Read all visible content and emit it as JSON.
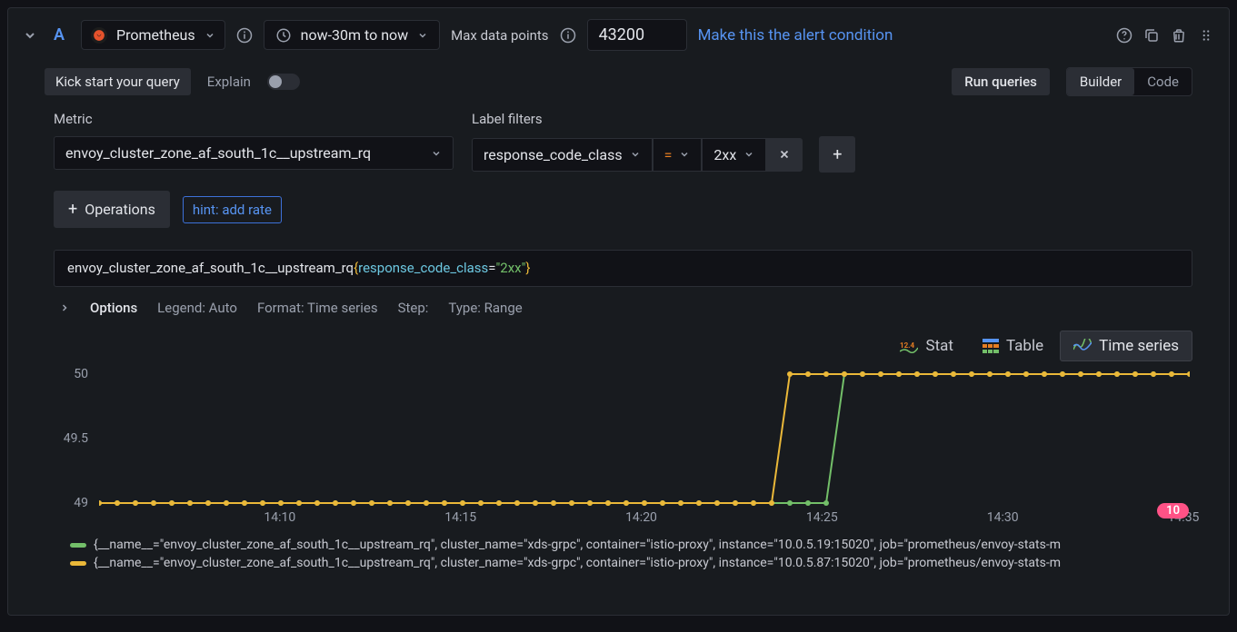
{
  "header": {
    "query_letter": "A",
    "datasource": "Prometheus",
    "time_range": "now-30m to now",
    "max_data_points_label": "Max data points",
    "max_data_points_value": "43200",
    "alert_link": "Make this the alert condition"
  },
  "row2": {
    "kick_start": "Kick start your query",
    "explain": "Explain",
    "run_queries": "Run queries",
    "builder": "Builder",
    "code": "Code"
  },
  "builder": {
    "metric_label": "Metric",
    "metric_value": "envoy_cluster_zone_af_south_1c__upstream_rq",
    "label_filters_label": "Label filters",
    "filter_key": "response_code_class",
    "filter_op": "=",
    "filter_value": "2xx",
    "operations_btn": "Operations",
    "hint": "hint: add rate"
  },
  "query_parts": {
    "metric": "envoy_cluster_zone_af_south_1c__upstream_rq",
    "label": "response_code_class",
    "eq": "=",
    "value": "\"2xx\""
  },
  "options": {
    "title": "Options",
    "legend": "Legend: Auto",
    "format": "Format: Time series",
    "step": "Step:",
    "type": "Type: Range"
  },
  "views": {
    "stat": "Stat",
    "table": "Table",
    "time_series": "Time series"
  },
  "chart_data": {
    "type": "line",
    "xlabel": "",
    "ylabel": "",
    "ylim": [
      49,
      50
    ],
    "y_ticks": [
      49,
      49.5,
      50
    ],
    "x_ticks": [
      "14:10",
      "14:15",
      "14:20",
      "14:25",
      "14:30",
      "14:35"
    ],
    "x_range_minutes": [
      0,
      30
    ],
    "x_tick_minutes": [
      5,
      10,
      15,
      20,
      25,
      30
    ],
    "series": [
      {
        "name": "{__name__=\"envoy_cluster_zone_af_south_1c__upstream_rq\", cluster_name=\"xds-grpc\", container=\"istio-proxy\", instance=\"10.0.5.19:15020\", job=\"prometheus/envoy-stats-m",
        "color": "#73bf69",
        "x": [
          0,
          0.5,
          1,
          1.5,
          2,
          2.5,
          3,
          3.5,
          4,
          4.5,
          5,
          5.5,
          6,
          6.5,
          7,
          7.5,
          8,
          8.5,
          9,
          9.5,
          10,
          10.5,
          11,
          11.5,
          12,
          12.5,
          13,
          13.5,
          14,
          14.5,
          15,
          15.5,
          16,
          16.5,
          17,
          17.5,
          18,
          18.5,
          19,
          19.5,
          20,
          20.5,
          21,
          21.5,
          22,
          22.5,
          23,
          23.5,
          24,
          24.5,
          25,
          25.5,
          26,
          26.5,
          27,
          27.5,
          28,
          28.5,
          29,
          29.5,
          30
        ],
        "y": [
          49,
          49,
          49,
          49,
          49,
          49,
          49,
          49,
          49,
          49,
          49,
          49,
          49,
          49,
          49,
          49,
          49,
          49,
          49,
          49,
          49,
          49,
          49,
          49,
          49,
          49,
          49,
          49,
          49,
          49,
          49,
          49,
          49,
          49,
          49,
          49,
          49,
          49,
          49,
          49,
          49,
          50,
          50,
          50,
          50,
          50,
          50,
          50,
          50,
          50,
          50,
          50,
          50,
          50,
          50,
          50,
          50,
          50,
          50,
          50,
          50
        ]
      },
      {
        "name": "{__name__=\"envoy_cluster_zone_af_south_1c__upstream_rq\", cluster_name=\"xds-grpc\", container=\"istio-proxy\", instance=\"10.0.5.87:15020\", job=\"prometheus/envoy-stats-m",
        "color": "#eab839",
        "x": [
          0,
          0.5,
          1,
          1.5,
          2,
          2.5,
          3,
          3.5,
          4,
          4.5,
          5,
          5.5,
          6,
          6.5,
          7,
          7.5,
          8,
          8.5,
          9,
          9.5,
          10,
          10.5,
          11,
          11.5,
          12,
          12.5,
          13,
          13.5,
          14,
          14.5,
          15,
          15.5,
          16,
          16.5,
          17,
          17.5,
          18,
          18.5,
          19,
          19.5,
          20,
          20.5,
          21,
          21.5,
          22,
          22.5,
          23,
          23.5,
          24,
          24.5,
          25,
          25.5,
          26,
          26.5,
          27,
          27.5,
          28,
          28.5,
          29,
          29.5,
          30
        ],
        "y": [
          49,
          49,
          49,
          49,
          49,
          49,
          49,
          49,
          49,
          49,
          49,
          49,
          49,
          49,
          49,
          49,
          49,
          49,
          49,
          49,
          49,
          49,
          49,
          49,
          49,
          49,
          49,
          49,
          49,
          49,
          49,
          49,
          49,
          49,
          49,
          49,
          49,
          49,
          50,
          50,
          50,
          50,
          50,
          50,
          50,
          50,
          50,
          50,
          50,
          50,
          50,
          50,
          50,
          50,
          50,
          50,
          50,
          50,
          50,
          50,
          50
        ]
      }
    ],
    "badge": "10"
  }
}
